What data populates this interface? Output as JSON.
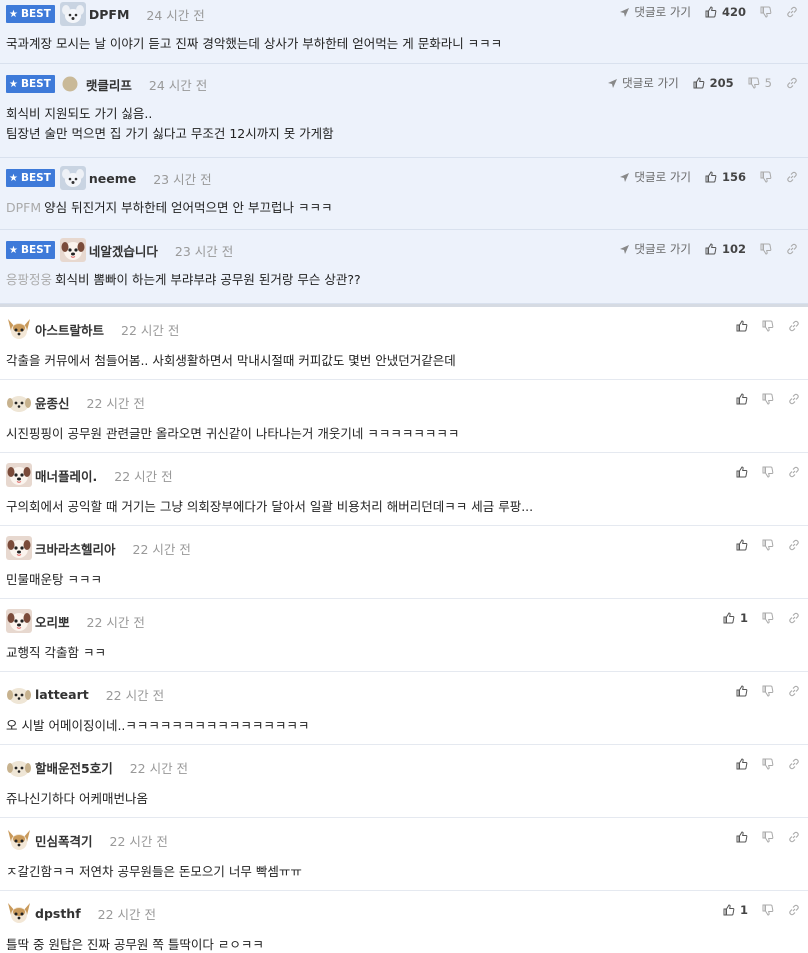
{
  "labels": {
    "best": "BEST",
    "reply_link": "댓글로 가기"
  },
  "colors": {
    "best_bg": "#edf2fb",
    "badge": "#3e7ad9"
  },
  "best_comments": [
    {
      "nick": "DPFM",
      "time": "24 시간 전",
      "mention": "",
      "lines": [
        "국과계장 모시는 날 이야기 듣고 진짜 경악했는데 상사가 부하한테 얻어먹는 게 문화라니 ㅋㅋㅋ"
      ],
      "likes": "420",
      "dislikes": "",
      "avatar": "dog-avatar"
    },
    {
      "nick": "랫클리프",
      "time": "24 시간 전",
      "mention": "",
      "lines": [
        "회식비 지원되도 가기 싫음..",
        "팀장년 술만 먹으면 집 가기 싫다고 무조건 12시까지 못 가게함"
      ],
      "likes": "205",
      "dislikes": "5",
      "avatar": "dot-avatar"
    },
    {
      "nick": "neeme",
      "time": "23 시간 전",
      "mention": "DPFM",
      "lines": [
        "양심 뒤진거지 부하한테 얻어먹으면 안 부끄럽나 ㅋㅋㅋ"
      ],
      "likes": "156",
      "dislikes": "",
      "avatar": "dog-avatar"
    },
    {
      "nick": "네알겠습니다",
      "time": "23 시간 전",
      "mention": "응팡정웅",
      "lines": [
        "회식비 뽐빠이 하는게 부랴부랴 공무원 된거랑 무슨 상관??"
      ],
      "likes": "102",
      "dislikes": "",
      "avatar": "pug-avatar"
    }
  ],
  "comments": [
    {
      "nick": "아스트랄하트",
      "time": "22 시간 전",
      "text": "각출을 커뮤에서 첨들어봄.. 사회생활하면서 막내시절때 커피값도 몇번 안냈던거같은데",
      "likes": "",
      "avatar": "chihuahua-avatar"
    },
    {
      "nick": "윤종신",
      "time": "22 시간 전",
      "text": "시진핑핑이 공무원 관련글만 올라오면 귀신같이 나타나는거 개웃기네 ㅋㅋㅋㅋㅋㅋㅋㅋ",
      "likes": "",
      "avatar": "puppy-avatar"
    },
    {
      "nick": "매너플레이.",
      "time": "22 시간 전",
      "text": "구의회에서 공익할 때 거기는 그냥 의회장부에다가 달아서 일괄 비용처리 해버리던데ㅋㅋ 세금 루팡...",
      "likes": "",
      "avatar": "pug-avatar"
    },
    {
      "nick": "크바라츠헬리아",
      "time": "22 시간 전",
      "text": "민물매운탕 ㅋㅋㅋ",
      "likes": "",
      "avatar": "pug-avatar"
    },
    {
      "nick": "오리뽀",
      "time": "22 시간 전",
      "text": "교행직 각출함 ㅋㅋ",
      "likes": "1",
      "avatar": "pug-avatar"
    },
    {
      "nick": "latteart",
      "time": "22 시간 전",
      "text": "오 시발 어메이징이네..ㅋㅋㅋㅋㅋㅋㅋㅋㅋㅋㅋㅋㅋㅋㅋㅋ",
      "likes": "",
      "avatar": "puppy-avatar"
    },
    {
      "nick": "할배운전5호기",
      "time": "22 시간 전",
      "text": "쥬나신기하다 어케매번나옴",
      "likes": "",
      "avatar": "puppy-avatar"
    },
    {
      "nick": "민심폭격기",
      "time": "22 시간 전",
      "text": "ㅈ갈긴함ㅋㅋ 저연차 공무원들은 돈모으기 너무 빡셈ㅠㅠ",
      "likes": "",
      "avatar": "chihuahua-avatar"
    },
    {
      "nick": "dpsthf",
      "time": "22 시간 전",
      "text": "틀딱 중 원탑은 진짜 공무원 쪽 틀딱이다 ㄹㅇㅋㅋ",
      "likes": "1",
      "avatar": "chihuahua-avatar"
    }
  ]
}
